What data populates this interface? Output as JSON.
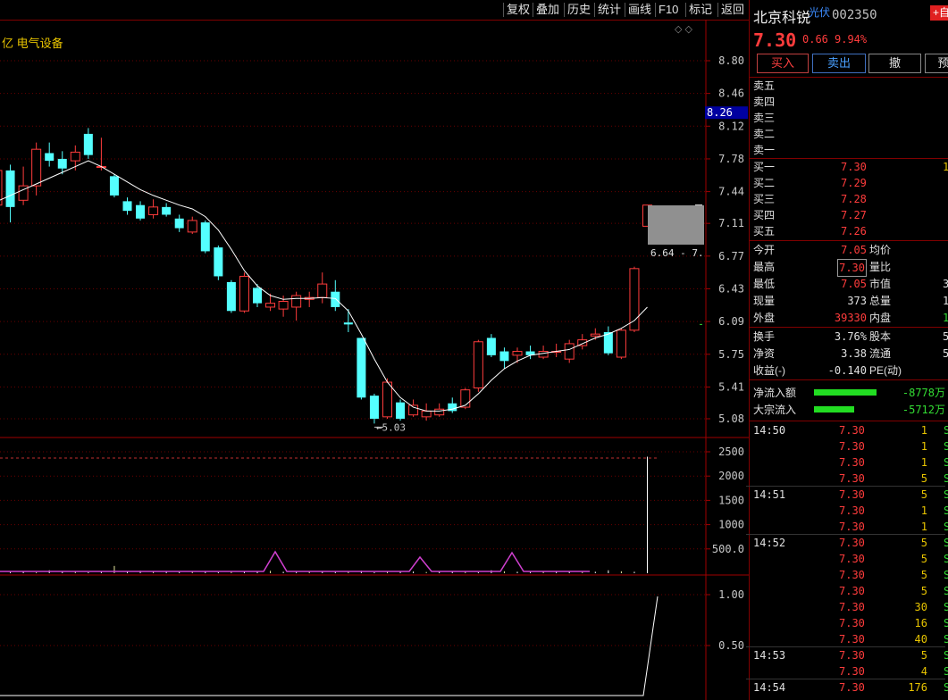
{
  "toolbar": {
    "buttons": [
      "复权",
      "叠加",
      "历史",
      "统计",
      "画线",
      "F10",
      "标记",
      "返回"
    ]
  },
  "sector": {
    "prefix": "亿",
    "name": "电气设备"
  },
  "chart_data": {
    "type": "candlestick",
    "price_axis": [
      "8.80",
      "8.46",
      "8.12",
      "7.78",
      "7.44",
      "7.11",
      "6.77",
      "6.43",
      "6.09",
      "5.75",
      "5.41",
      "5.08"
    ],
    "price_ylim": [
      5.08,
      8.8
    ],
    "current_price_marker": "8.26",
    "low_annotation": "5.03",
    "range_box_label": "6.64 - 7.",
    "volume_axis": [
      "2500",
      "2000",
      "1500",
      "1000",
      "500.0"
    ],
    "indicator_axis": [
      "1.00",
      "0.50"
    ],
    "candles": [
      {
        "o": 7.3,
        "c": 7.66,
        "h": 7.78,
        "l": 7.1
      },
      {
        "o": 7.66,
        "c": 7.28,
        "h": 7.72,
        "l": 7.12
      },
      {
        "o": 7.35,
        "c": 7.5,
        "h": 7.7,
        "l": 7.3
      },
      {
        "o": 7.5,
        "c": 7.88,
        "h": 7.95,
        "l": 7.4
      },
      {
        "o": 7.84,
        "c": 7.76,
        "h": 7.95,
        "l": 7.7
      },
      {
        "o": 7.78,
        "c": 7.68,
        "h": 7.86,
        "l": 7.62
      },
      {
        "o": 7.76,
        "c": 7.85,
        "h": 7.92,
        "l": 7.66
      },
      {
        "o": 8.04,
        "c": 7.82,
        "h": 8.1,
        "l": 7.78
      },
      {
        "o": 7.7,
        "c": 7.7,
        "h": 8.0,
        "l": 7.66
      },
      {
        "o": 7.6,
        "c": 7.4,
        "h": 7.62,
        "l": 7.38
      },
      {
        "o": 7.34,
        "c": 7.24,
        "h": 7.38,
        "l": 7.2
      },
      {
        "o": 7.3,
        "c": 7.16,
        "h": 7.34,
        "l": 7.14
      },
      {
        "o": 7.2,
        "c": 7.28,
        "h": 7.36,
        "l": 7.16
      },
      {
        "o": 7.28,
        "c": 7.2,
        "h": 7.32,
        "l": 7.18
      },
      {
        "o": 7.16,
        "c": 7.06,
        "h": 7.2,
        "l": 7.02
      },
      {
        "o": 7.02,
        "c": 7.14,
        "h": 7.18,
        "l": 7.0
      },
      {
        "o": 7.12,
        "c": 6.82,
        "h": 7.14,
        "l": 6.8
      },
      {
        "o": 6.86,
        "c": 6.56,
        "h": 6.88,
        "l": 6.52
      },
      {
        "o": 6.5,
        "c": 6.2,
        "h": 6.52,
        "l": 6.18
      },
      {
        "o": 6.2,
        "c": 6.56,
        "h": 6.6,
        "l": 6.18
      },
      {
        "o": 6.44,
        "c": 6.28,
        "h": 6.48,
        "l": 6.24
      },
      {
        "o": 6.24,
        "c": 6.28,
        "h": 6.38,
        "l": 6.2
      },
      {
        "o": 6.22,
        "c": 6.3,
        "h": 6.36,
        "l": 6.14
      },
      {
        "o": 6.24,
        "c": 6.36,
        "h": 6.4,
        "l": 6.1
      },
      {
        "o": 6.32,
        "c": 6.34,
        "h": 6.4,
        "l": 6.24
      },
      {
        "o": 6.34,
        "c": 6.48,
        "h": 6.6,
        "l": 6.28
      },
      {
        "o": 6.4,
        "c": 6.24,
        "h": 6.52,
        "l": 6.2
      },
      {
        "o": 6.08,
        "c": 6.06,
        "h": 6.22,
        "l": 5.98
      },
      {
        "o": 5.92,
        "c": 5.3,
        "h": 5.92,
        "l": 5.28
      },
      {
        "o": 5.32,
        "c": 5.08,
        "h": 5.34,
        "l": 5.03
      },
      {
        "o": 5.1,
        "c": 5.46,
        "h": 5.5,
        "l": 5.08
      },
      {
        "o": 5.25,
        "c": 5.08,
        "h": 5.28,
        "l": 5.06
      },
      {
        "o": 5.12,
        "c": 5.22,
        "h": 5.28,
        "l": 5.1
      },
      {
        "o": 5.1,
        "c": 5.16,
        "h": 5.24,
        "l": 5.06
      },
      {
        "o": 5.12,
        "c": 5.18,
        "h": 5.24,
        "l": 5.1
      },
      {
        "o": 5.24,
        "c": 5.16,
        "h": 5.3,
        "l": 5.14
      },
      {
        "o": 5.2,
        "c": 5.38,
        "h": 5.4,
        "l": 5.18
      },
      {
        "o": 5.4,
        "c": 5.88,
        "h": 5.9,
        "l": 5.36
      },
      {
        "o": 5.92,
        "c": 5.74,
        "h": 5.96,
        "l": 5.72
      },
      {
        "o": 5.78,
        "c": 5.68,
        "h": 5.82,
        "l": 5.6
      },
      {
        "o": 5.74,
        "c": 5.78,
        "h": 5.82,
        "l": 5.66
      },
      {
        "o": 5.78,
        "c": 5.74,
        "h": 5.84,
        "l": 5.7
      },
      {
        "o": 5.72,
        "c": 5.78,
        "h": 5.84,
        "l": 5.7
      },
      {
        "o": 5.78,
        "c": 5.78,
        "h": 5.86,
        "l": 5.72
      },
      {
        "o": 5.7,
        "c": 5.86,
        "h": 5.9,
        "l": 5.66
      },
      {
        "o": 5.84,
        "c": 5.9,
        "h": 5.96,
        "l": 5.8
      },
      {
        "o": 5.94,
        "c": 5.96,
        "h": 6.02,
        "l": 5.9
      },
      {
        "o": 5.98,
        "c": 5.76,
        "h": 6.04,
        "l": 5.74
      },
      {
        "o": 5.72,
        "c": 6.0,
        "h": 6.02,
        "l": 5.7
      },
      {
        "o": 6.0,
        "c": 6.64,
        "h": 6.66,
        "l": 5.98
      },
      {
        "o": 7.08,
        "c": 7.3,
        "h": 7.3,
        "l": 7.08
      }
    ],
    "ma_line": [
      7.34,
      7.4,
      7.46,
      7.52,
      7.58,
      7.64,
      7.7,
      7.76,
      7.7,
      7.62,
      7.54,
      7.46,
      7.4,
      7.35,
      7.3,
      7.26,
      7.18,
      7.04,
      6.84,
      6.62,
      6.46,
      6.36,
      6.32,
      6.33,
      6.33,
      6.34,
      6.33,
      6.2,
      5.96,
      5.7,
      5.46,
      5.3,
      5.2,
      5.16,
      5.16,
      5.18,
      5.22,
      5.34,
      5.48,
      5.6,
      5.68,
      5.74,
      5.76,
      5.78,
      5.8,
      5.86,
      5.92,
      5.96,
      6.02,
      6.1,
      6.24
    ],
    "volumes": [
      30,
      25,
      40,
      20,
      60,
      30,
      45,
      20,
      35,
      150,
      30,
      50,
      40,
      30,
      25,
      40,
      30,
      20,
      45,
      30,
      35,
      50,
      30,
      25,
      30,
      40,
      25,
      30,
      50,
      20,
      30,
      40,
      35,
      25,
      30,
      45,
      30,
      20,
      60,
      40,
      30,
      25,
      30,
      40,
      30,
      25,
      30,
      60,
      40,
      30,
      2400
    ]
  },
  "right": {
    "stock_name": "北京科锐",
    "tag": "光伏",
    "code": "002350",
    "plus_label": "+自",
    "price": "7.30",
    "change": "0.66",
    "change_pct": "9.94%",
    "buy_label": "买入",
    "sell_label": "卖出",
    "cancel_label": "撤",
    "pre_label": "预",
    "asks": [
      {
        "label": "卖五",
        "price": "",
        "vol": ""
      },
      {
        "label": "卖四",
        "price": "",
        "vol": ""
      },
      {
        "label": "卖三",
        "price": "",
        "vol": ""
      },
      {
        "label": "卖二",
        "price": "",
        "vol": ""
      },
      {
        "label": "卖一",
        "price": "",
        "vol": ""
      }
    ],
    "bids": [
      {
        "label": "买一",
        "price": "7.30",
        "vol": "1"
      },
      {
        "label": "买二",
        "price": "7.29",
        "vol": ""
      },
      {
        "label": "买三",
        "price": "7.28",
        "vol": ""
      },
      {
        "label": "买四",
        "price": "7.27",
        "vol": ""
      },
      {
        "label": "买五",
        "price": "7.26",
        "vol": ""
      }
    ],
    "quotes": [
      {
        "l1": "今开",
        "v1": "7.05",
        "l2": "均价",
        "v2": ""
      },
      {
        "l1": "最高",
        "v1": "7.30",
        "l2": "量比",
        "v2": ""
      },
      {
        "l1": "最低",
        "v1": "7.05",
        "l2": "市值",
        "v2": "3"
      },
      {
        "l1": "现量",
        "v1": "373",
        "l2": "总量",
        "v2": "1"
      },
      {
        "l1": "外盘",
        "v1": "39330",
        "l2": "内盘",
        "v2": "1"
      }
    ],
    "quotes2": [
      {
        "l1": "换手",
        "v1": "3.76%",
        "l2": "股本",
        "v2": "5"
      },
      {
        "l1": "净资",
        "v1": "3.38",
        "l2": "流通",
        "v2": "5"
      },
      {
        "l1": "收益(-)",
        "v1": "-0.140",
        "l2": "PE(动)",
        "v2": ""
      }
    ],
    "flows": [
      {
        "label": "净流入额",
        "value": "-8778万",
        "bar": 70
      },
      {
        "label": "大宗流入",
        "value": "-5712万",
        "bar": 45
      }
    ],
    "ticks": [
      {
        "t": "14:50",
        "p": "7.30",
        "v": "1",
        "s": "S"
      },
      {
        "t": "",
        "p": "7.30",
        "v": "1",
        "s": "S"
      },
      {
        "t": "",
        "p": "7.30",
        "v": "1",
        "s": "S"
      },
      {
        "t": "",
        "p": "7.30",
        "v": "5",
        "s": "S"
      },
      {
        "t": "14:51",
        "p": "7.30",
        "v": "5",
        "s": "S"
      },
      {
        "t": "",
        "p": "7.30",
        "v": "1",
        "s": "S"
      },
      {
        "t": "",
        "p": "7.30",
        "v": "1",
        "s": "S"
      },
      {
        "t": "14:52",
        "p": "7.30",
        "v": "5",
        "s": "S"
      },
      {
        "t": "",
        "p": "7.30",
        "v": "5",
        "s": "S"
      },
      {
        "t": "",
        "p": "7.30",
        "v": "5",
        "s": "S"
      },
      {
        "t": "",
        "p": "7.30",
        "v": "5",
        "s": "S"
      },
      {
        "t": "",
        "p": "7.30",
        "v": "30",
        "s": "S"
      },
      {
        "t": "",
        "p": "7.30",
        "v": "16",
        "s": "S"
      },
      {
        "t": "",
        "p": "7.30",
        "v": "40",
        "s": "S"
      },
      {
        "t": "14:53",
        "p": "7.30",
        "v": "5",
        "s": "S"
      },
      {
        "t": "",
        "p": "7.30",
        "v": "4",
        "s": "S"
      },
      {
        "t": "14:54",
        "p": "7.30",
        "v": "176",
        "s": "S"
      }
    ]
  }
}
